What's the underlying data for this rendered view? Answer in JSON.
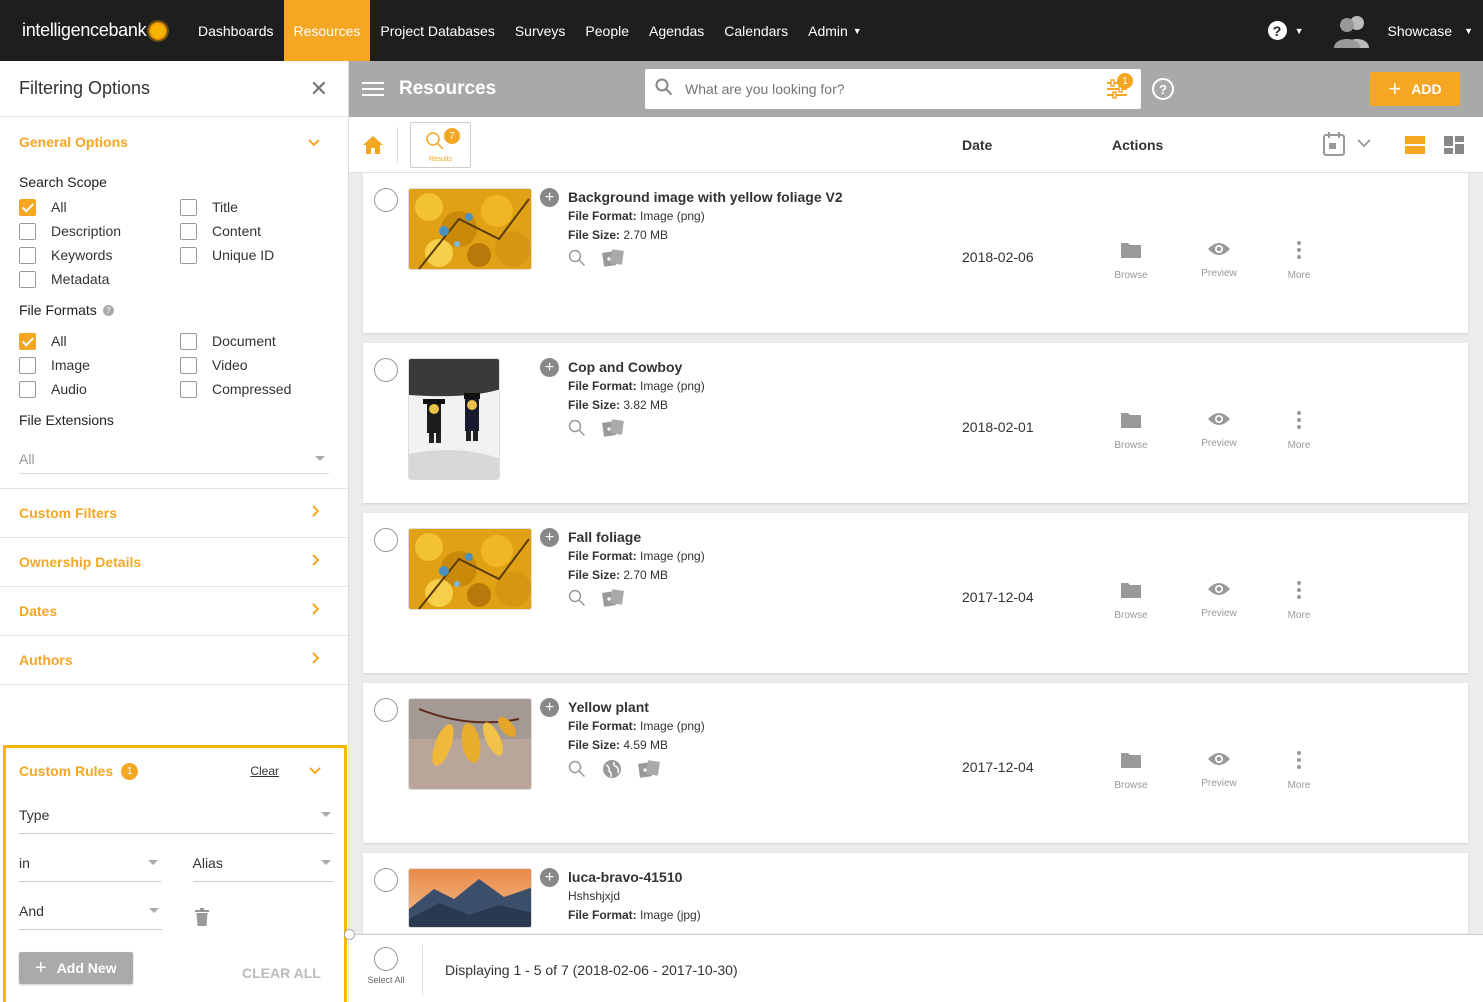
{
  "app": {
    "brand": "intelligencebank",
    "nav": [
      {
        "label": "Dashboards",
        "active": false
      },
      {
        "label": "Resources",
        "active": true
      },
      {
        "label": "Project Databases",
        "active": false
      },
      {
        "label": "Surveys",
        "active": false
      },
      {
        "label": "People",
        "active": false
      },
      {
        "label": "Agendas",
        "active": false
      },
      {
        "label": "Calendars",
        "active": false
      },
      {
        "label": "Admin",
        "active": false
      }
    ],
    "help_symbol": "?",
    "user": "Showcase",
    "accent": "#f5a623"
  },
  "sidebar": {
    "title": "Filtering Options",
    "close_symbol": "✕",
    "general": {
      "label": "General Options",
      "search_scope": {
        "title": "Search Scope",
        "options": [
          {
            "label": "All",
            "checked": true
          },
          {
            "label": "Title",
            "checked": false
          },
          {
            "label": "Description",
            "checked": false
          },
          {
            "label": "Content",
            "checked": false
          },
          {
            "label": "Keywords",
            "checked": false
          },
          {
            "label": "Unique ID",
            "checked": false
          },
          {
            "label": "Metadata",
            "checked": false
          }
        ]
      },
      "file_formats": {
        "title": "File Formats",
        "options": [
          {
            "label": "All",
            "checked": true
          },
          {
            "label": "Document",
            "checked": false
          },
          {
            "label": "Image",
            "checked": false
          },
          {
            "label": "Video",
            "checked": false
          },
          {
            "label": "Audio",
            "checked": false
          },
          {
            "label": "Compressed",
            "checked": false
          }
        ]
      },
      "file_extensions": {
        "title": "File Extensions",
        "value": "All"
      }
    },
    "sections": [
      "Custom Filters",
      "Ownership Details",
      "Dates",
      "Authors"
    ],
    "custom_rules": {
      "label": "Custom Rules",
      "count": "1",
      "clear": "Clear",
      "field": "Type",
      "operator": "in",
      "value": "Alias",
      "joiner": "And",
      "add_new": "Add New"
    },
    "clear_all": "CLEAR ALL"
  },
  "toolbar": {
    "title": "Resources",
    "search_placeholder": "What are you looking for?",
    "filter_count": "1",
    "help_symbol": "?",
    "add_label": "ADD"
  },
  "results_bar": {
    "results_label": "Results",
    "results_count": "7",
    "col_date": "Date",
    "col_actions": "Actions"
  },
  "items": [
    {
      "name": "Background image with yellow foliage V2",
      "format_label": "File Format:",
      "format": "Image (png)",
      "size_label": "File Size:",
      "size": "2.70 MB",
      "date": "2018-02-06",
      "thumb": "foliage",
      "globe": false
    },
    {
      "name": "Cop and Cowboy",
      "format_label": "File Format:",
      "format": "Image (png)",
      "size_label": "File Size:",
      "size": "3.82 MB",
      "date": "2018-02-01",
      "thumb": "lego",
      "globe": false
    },
    {
      "name": "Fall foliage",
      "format_label": "File Format:",
      "format": "Image (png)",
      "size_label": "File Size:",
      "size": "2.70 MB",
      "date": "2017-12-04",
      "thumb": "foliage",
      "globe": false
    },
    {
      "name": "Yellow plant",
      "format_label": "File Format:",
      "format": "Image (png)",
      "size_label": "File Size:",
      "size": "4.59 MB",
      "date": "2017-12-04",
      "thumb": "plant",
      "globe": true
    },
    {
      "name": "luca-bravo-41510",
      "format_label": "File Format:",
      "format": "Image (jpg)",
      "description": "Hshshjxjd",
      "date": "",
      "thumb": "mountain",
      "globe": false
    }
  ],
  "actions": {
    "browse": "Browse",
    "preview": "Preview",
    "more": "More"
  },
  "footer": {
    "select_all": "Select All",
    "displaying": "Displaying 1 - 5 of 7 (2018-02-06 - 2017-10-30)"
  }
}
